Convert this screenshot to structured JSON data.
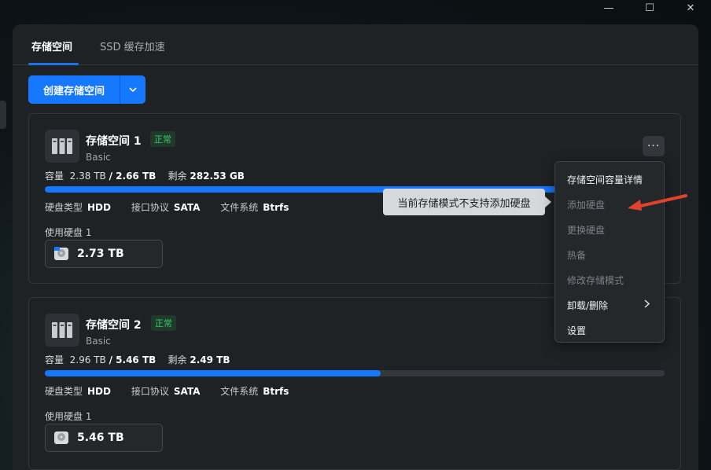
{
  "window": {
    "minimize_glyph": "—",
    "maximize_glyph": "☐",
    "close_glyph": "✕"
  },
  "tabs": [
    {
      "label": "存储空间",
      "active": true
    },
    {
      "label": "SSD 缓存加速",
      "active": false
    }
  ],
  "toolbar": {
    "create_label": "创建存储空间"
  },
  "volumes": [
    {
      "title": "存储空间 1",
      "status": "正常",
      "raid": "Basic",
      "capacity_label": "容量",
      "used": "2.38 TB",
      "total": "/ 2.66 TB",
      "remaining_label": "剩余",
      "remaining": "282.53 GB",
      "usage_fraction": 0.894,
      "disk_type_label": "硬盘类型",
      "disk_type": "HDD",
      "interface_label": "接口协议",
      "interface": "SATA",
      "fs_label": "文件系统",
      "fs": "Btrfs",
      "used_disks_label": "使用硬盘 1",
      "disk_size": "2.73 TB",
      "more_glyph": "···"
    },
    {
      "title": "存储空间 2",
      "status": "正常",
      "raid": "Basic",
      "capacity_label": "容量",
      "used": "2.96 TB",
      "total": "/ 5.46 TB",
      "remaining_label": "剩余",
      "remaining": "2.49 TB",
      "usage_fraction": 0.542,
      "disk_type_label": "硬盘类型",
      "disk_type": "HDD",
      "interface_label": "接口协议",
      "interface": "SATA",
      "fs_label": "文件系统",
      "fs": "Btrfs",
      "used_disks_label": "使用硬盘 1",
      "disk_size": "5.46 TB"
    }
  ],
  "context_menu": {
    "items": [
      {
        "label": "存储空间容量详情",
        "enabled": true
      },
      {
        "label": "添加硬盘",
        "enabled": false
      },
      {
        "label": "更换硬盘",
        "enabled": false
      },
      {
        "label": "热备",
        "enabled": false
      },
      {
        "label": "修改存储模式",
        "enabled": false
      },
      {
        "label": "卸载/删除",
        "enabled": true,
        "submenu": true
      },
      {
        "label": "设置",
        "enabled": true
      }
    ]
  },
  "tooltip": {
    "text": "当前存储模式不支持添加硬盘"
  },
  "colors": {
    "accent": "#1677ff",
    "status_ok": "#3ec46d",
    "annotation": "#e0422c"
  }
}
